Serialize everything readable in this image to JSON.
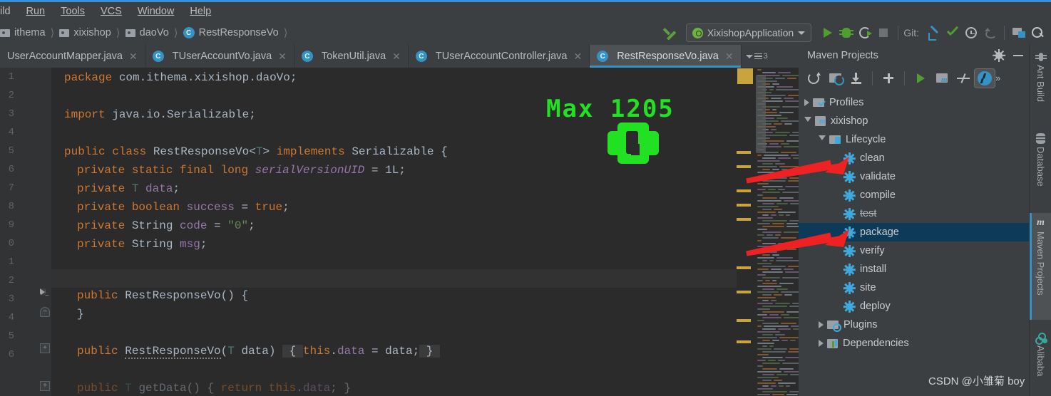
{
  "menubar": {
    "items": [
      {
        "label": "ild",
        "mnemonic": ""
      },
      {
        "label": "Run",
        "mnemonic": "R"
      },
      {
        "label": "Tools",
        "mnemonic": "T"
      },
      {
        "label": "VCS",
        "mnemonic": "S"
      },
      {
        "label": "Window",
        "mnemonic": "W"
      },
      {
        "label": "Help",
        "mnemonic": "H"
      }
    ]
  },
  "breadcrumb": {
    "items": [
      {
        "label": "ithema",
        "icon": "folder-icon"
      },
      {
        "label": "xixishop",
        "icon": "folder-icon"
      },
      {
        "label": "daoVo",
        "icon": "folder-icon"
      },
      {
        "label": "RestResponseVo",
        "icon": "java-class-icon"
      }
    ],
    "separator": "❯"
  },
  "toolbar": {
    "jump_to_source_icon": "arrow-up-left-icon",
    "run_config": {
      "name": "XixishopApplication",
      "icon": "spring-boot-icon",
      "dropdown_icon": "chevron-down-icon"
    },
    "run_icon": "run-icon",
    "debug_icon": "debug-icon",
    "run_with_coverage_icon": "run-with-coverage-icon",
    "stop_icon": "stop-icon",
    "git_label": "Git:",
    "git_update_icon": "git-update-icon",
    "git_commit_icon": "git-commit-icon",
    "git_history_icon": "git-history-icon",
    "git_rollback_icon": "git-rollback-icon",
    "project_structure_icon": "project-structure-icon",
    "search_everywhere_icon": "search-icon"
  },
  "tabs": {
    "items": [
      {
        "label": "UserAccountMapper.java",
        "icon": "",
        "active": false
      },
      {
        "label": "TUserAccountVo.java",
        "icon": "java-class-icon",
        "active": false
      },
      {
        "label": "TokenUtil.java",
        "icon": "java-class-icon",
        "active": false
      },
      {
        "label": "TUserAccountController.java",
        "icon": "java-class-icon",
        "active": false
      },
      {
        "label": "RestResponseVo.java",
        "icon": "java-class-icon",
        "active": true
      }
    ],
    "overflow_count": "3",
    "close_icon": "close-icon"
  },
  "editor": {
    "line_numbers": [
      "1",
      "2",
      "3",
      "4",
      "5",
      "6",
      "7",
      "8",
      "9",
      "0",
      "1",
      "2",
      "3",
      "4",
      "5",
      "6"
    ],
    "lines": [
      "package com.ithema.xixishop.daoVo;",
      "",
      "import java.io.Serializable;",
      "",
      "public class RestResponseVo<T> implements Serializable {",
      "    private static final long serialVersionUID = 1L;",
      "    private T data;",
      "    private boolean success = true;",
      "    private String code = \"0\";",
      "    private String msg;",
      "",
      "    public RestResponseVo() {",
      "    }",
      "",
      "    public RestResponseVo(T data) { this.data = data; }",
      "",
      "    public T getData() { return this.data; }"
    ]
  },
  "overlay": {
    "max_text": "Max 1205",
    "max_color": "#22e022"
  },
  "maven": {
    "title": "Maven Projects",
    "settings_icon": "gear-icon",
    "hide_icon": "minimize-icon",
    "toolbar": [
      {
        "name": "reimport-icon"
      },
      {
        "name": "generate-sources-icon"
      },
      {
        "name": "download-sources-icon"
      },
      {
        "name": "add-maven-project-icon"
      },
      {
        "name": "run-maven-build-icon"
      },
      {
        "name": "execute-maven-goal-icon"
      },
      {
        "name": "toggle-skip-tests-icon"
      },
      {
        "name": "toggle-offline-mode-icon"
      }
    ],
    "overflow_icon": "chevron-double-right-icon",
    "tree": [
      {
        "label": "Profiles",
        "indent": 0,
        "icon": "profiles-folder-icon",
        "expander": "collapsed",
        "selected": false,
        "strike": false
      },
      {
        "label": "xixishop",
        "indent": 0,
        "icon": "maven-project-icon",
        "expander": "expanded",
        "selected": false,
        "strike": false
      },
      {
        "label": "Lifecycle",
        "indent": 1,
        "icon": "lifecycle-folder-icon",
        "expander": "expanded",
        "selected": false,
        "strike": false
      },
      {
        "label": "clean",
        "indent": 2,
        "icon": "maven-goal-icon",
        "expander": "none",
        "selected": false,
        "strike": false
      },
      {
        "label": "validate",
        "indent": 2,
        "icon": "maven-goal-icon",
        "expander": "none",
        "selected": false,
        "strike": false
      },
      {
        "label": "compile",
        "indent": 2,
        "icon": "maven-goal-icon",
        "expander": "none",
        "selected": false,
        "strike": false
      },
      {
        "label": "test",
        "indent": 2,
        "icon": "maven-goal-icon",
        "expander": "none",
        "selected": false,
        "strike": true
      },
      {
        "label": "package",
        "indent": 2,
        "icon": "maven-goal-icon",
        "expander": "none",
        "selected": true,
        "strike": false
      },
      {
        "label": "verify",
        "indent": 2,
        "icon": "maven-goal-icon",
        "expander": "none",
        "selected": false,
        "strike": false
      },
      {
        "label": "install",
        "indent": 2,
        "icon": "maven-goal-icon",
        "expander": "none",
        "selected": false,
        "strike": false
      },
      {
        "label": "site",
        "indent": 2,
        "icon": "maven-goal-icon",
        "expander": "none",
        "selected": false,
        "strike": false
      },
      {
        "label": "deploy",
        "indent": 2,
        "icon": "maven-goal-icon",
        "expander": "none",
        "selected": false,
        "strike": false
      },
      {
        "label": "Plugins",
        "indent": 1,
        "icon": "plugins-folder-icon",
        "expander": "collapsed",
        "selected": false,
        "strike": false
      },
      {
        "label": "Dependencies",
        "indent": 1,
        "icon": "dependencies-folder-icon",
        "expander": "collapsed",
        "selected": false,
        "strike": false
      }
    ]
  },
  "tool_strip": {
    "items": [
      {
        "label": "Ant Build",
        "icon": "ant-icon",
        "active": false
      },
      {
        "label": "Database",
        "icon": "database-icon",
        "active": false
      },
      {
        "label": "Maven Projects",
        "icon": "maven-icon",
        "active": true
      },
      {
        "label": "Alibaba",
        "icon": "alibaba-icon",
        "active": false
      }
    ]
  },
  "watermark": {
    "text": "CSDN @小雏菊 boy"
  },
  "annotations": {
    "arrow_color": "#ee2222",
    "arrows": [
      {
        "target": "clean"
      },
      {
        "target": "package"
      }
    ]
  }
}
